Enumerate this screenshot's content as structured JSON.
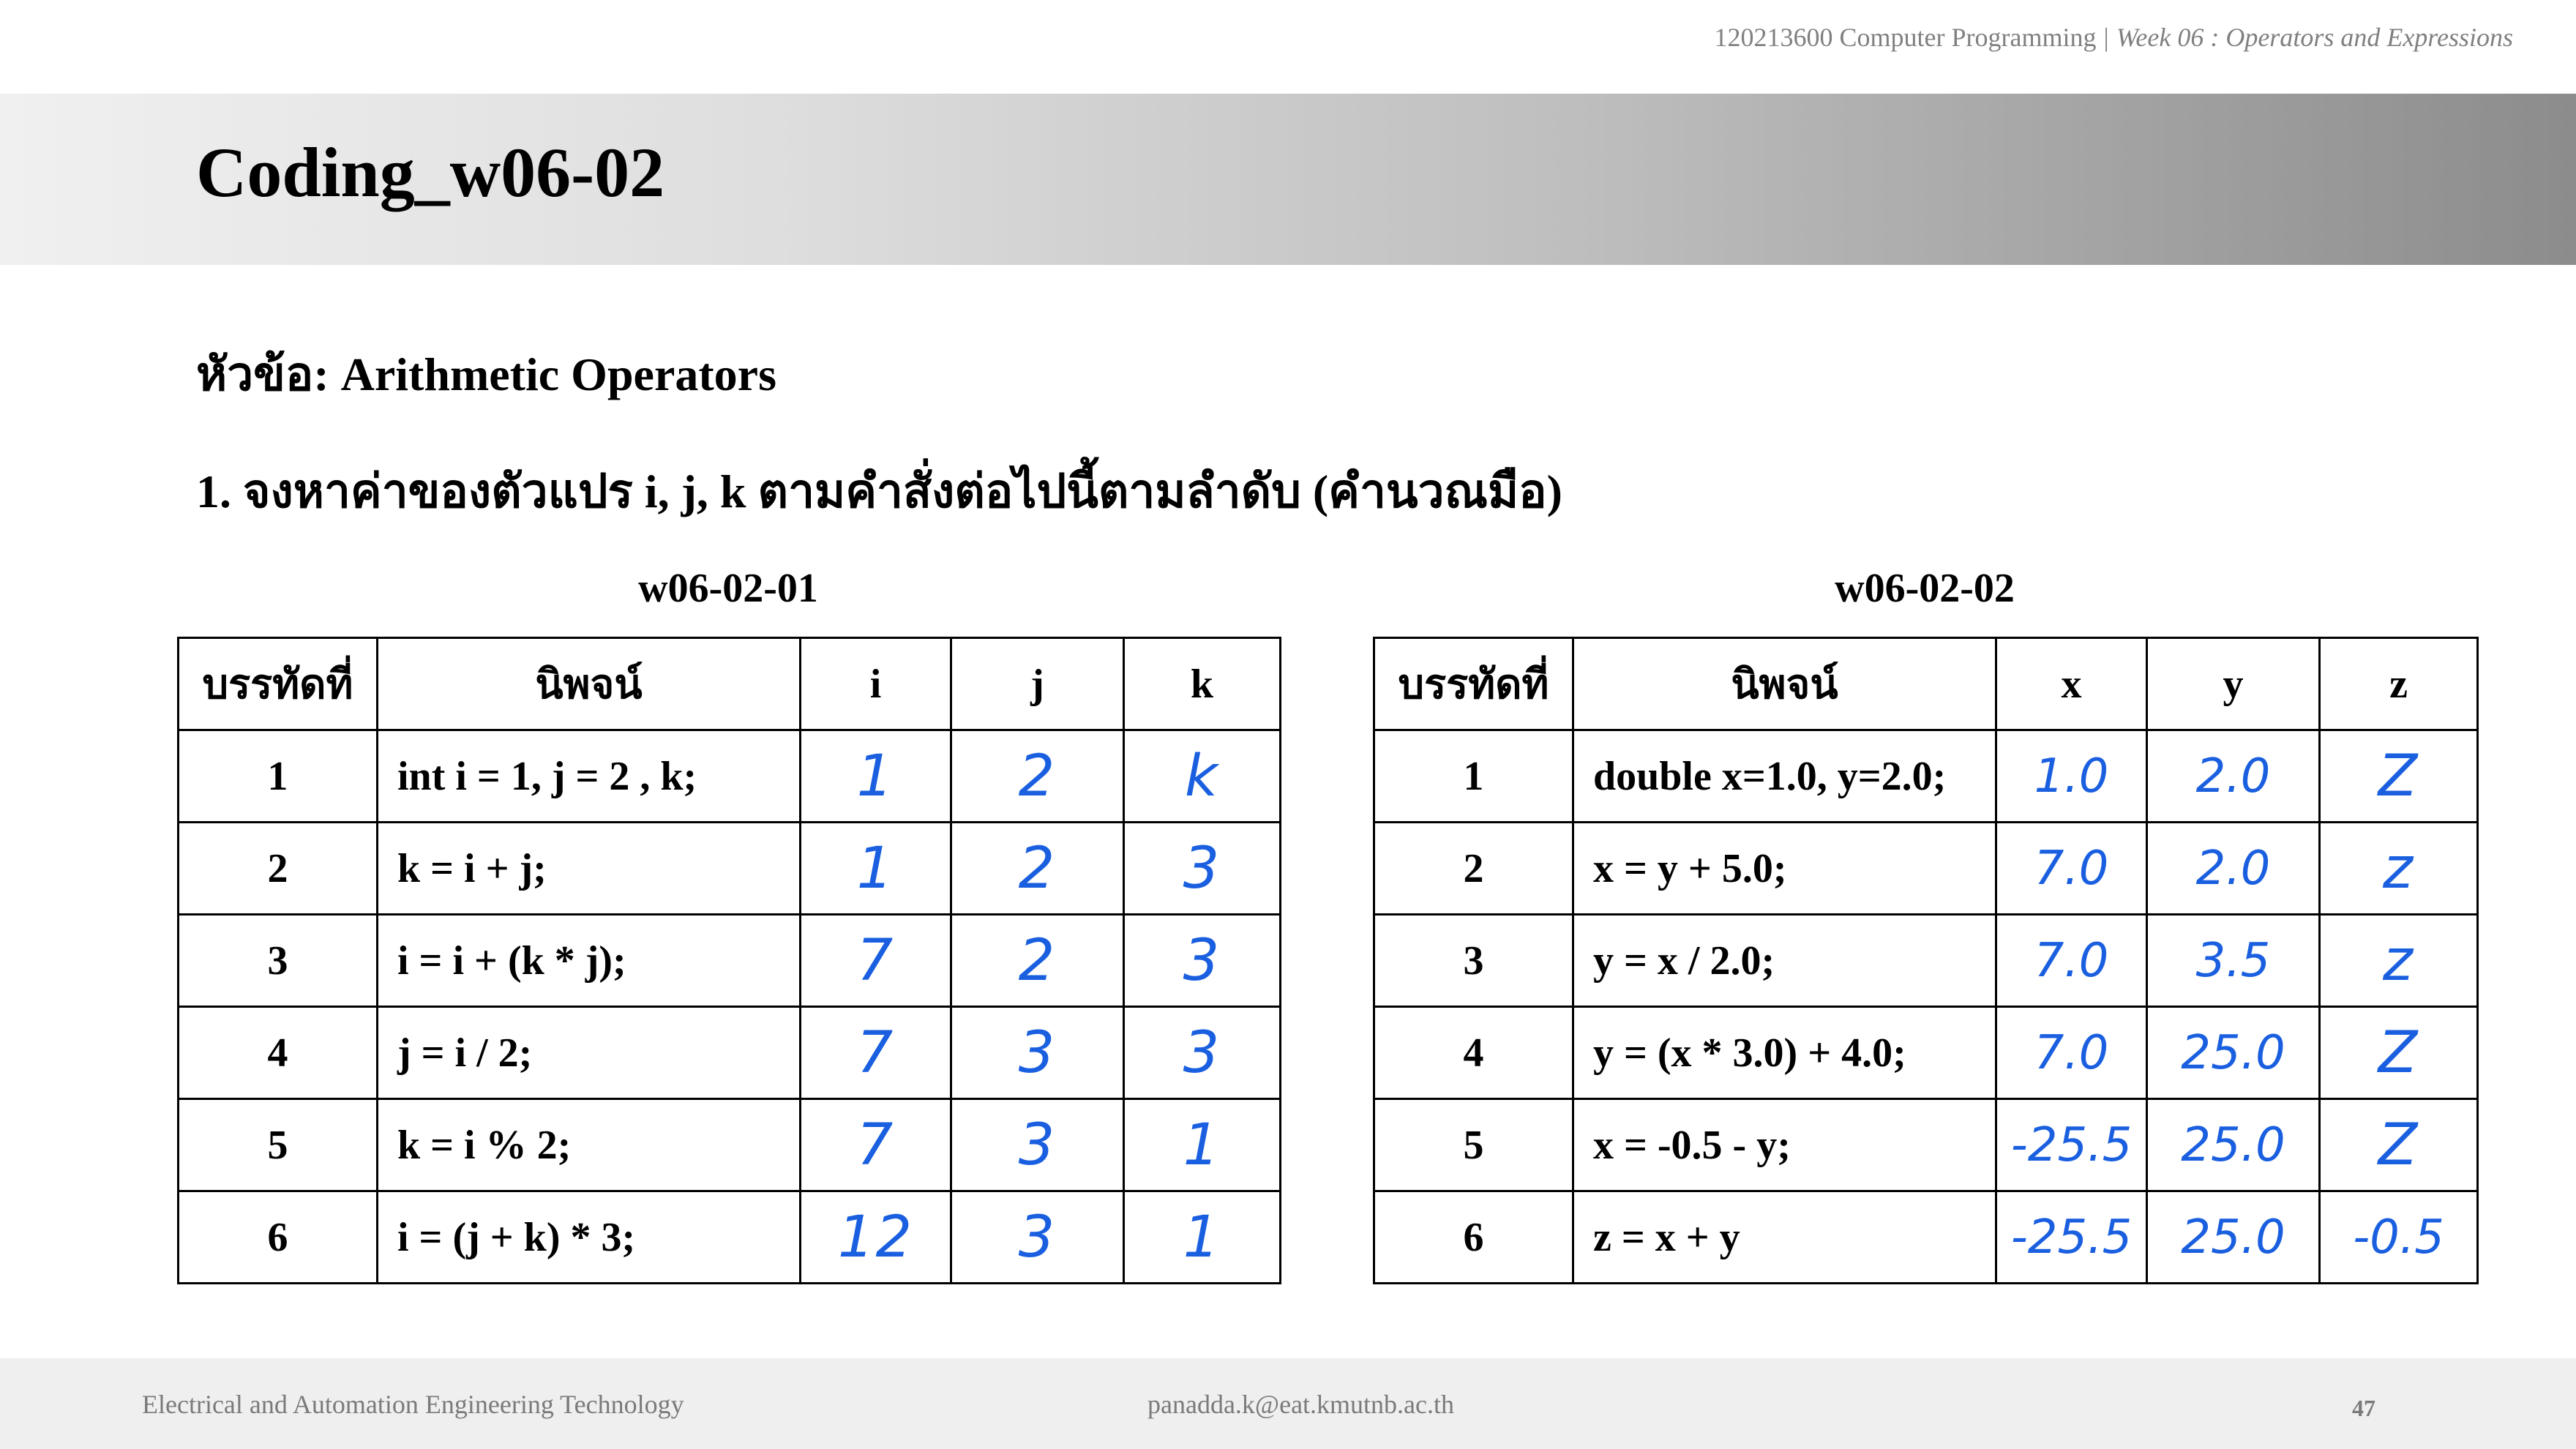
{
  "header": {
    "course": "120213600 Computer Programming",
    "separator": "|",
    "week": "Week 06 : Operators and Expressions"
  },
  "title": "Coding_w06-02",
  "topic": "หัวข้อ: Arithmetic Operators",
  "instruction": "1. จงหาค่าของตัวแปร i, j, k ตามคำสั่งต่อไปนี้ตามลำดับ (คำนวณมือ)",
  "tables": [
    {
      "caption": "w06-02-01",
      "headers": [
        "บรรทัดที่",
        "นิพจน์",
        "i",
        "j",
        "k"
      ],
      "rows": [
        {
          "line": "1",
          "expr": "int i = 1, j = 2 , k;",
          "answers": [
            "1",
            "2",
            "k"
          ]
        },
        {
          "line": "2",
          "expr": "k = i + j;",
          "answers": [
            "1",
            "2",
            "3"
          ]
        },
        {
          "line": "3",
          "expr": "i = i + (k * j);",
          "answers": [
            "7",
            "2",
            "3"
          ]
        },
        {
          "line": "4",
          "expr": "j = i / 2;",
          "answers": [
            "7",
            "3",
            "3"
          ]
        },
        {
          "line": "5",
          "expr": "k = i % 2;",
          "answers": [
            "7",
            "3",
            "1"
          ]
        },
        {
          "line": "6",
          "expr": "i = (j + k) * 3;",
          "answers": [
            "12",
            "3",
            "1"
          ]
        }
      ]
    },
    {
      "caption": "w06-02-02",
      "headers": [
        "บรรทัดที่",
        "นิพจน์",
        "x",
        "y",
        "z"
      ],
      "rows": [
        {
          "line": "1",
          "expr": "double x=1.0, y=2.0;",
          "answers": [
            "1.0",
            "2.0",
            "Z"
          ]
        },
        {
          "line": "2",
          "expr": "x = y + 5.0;",
          "answers": [
            "7.0",
            "2.0",
            "z"
          ]
        },
        {
          "line": "3",
          "expr": "y = x / 2.0;",
          "answers": [
            "7.0",
            "3.5",
            "z"
          ]
        },
        {
          "line": "4",
          "expr": "y = (x * 3.0) + 4.0;",
          "answers": [
            "7.0",
            "25.0",
            "Z"
          ]
        },
        {
          "line": "5",
          "expr": "x = -0.5 - y;",
          "answers": [
            "-25.5",
            "25.0",
            "Z"
          ]
        },
        {
          "line": "6",
          "expr": "z = x + y",
          "answers": [
            "-25.5",
            "25.0",
            "-0.5"
          ]
        }
      ]
    }
  ],
  "footer": {
    "left": "Electrical and Automation Engineering Technology",
    "center": "panadda.k@eat.kmutnb.ac.th",
    "page": "47"
  }
}
